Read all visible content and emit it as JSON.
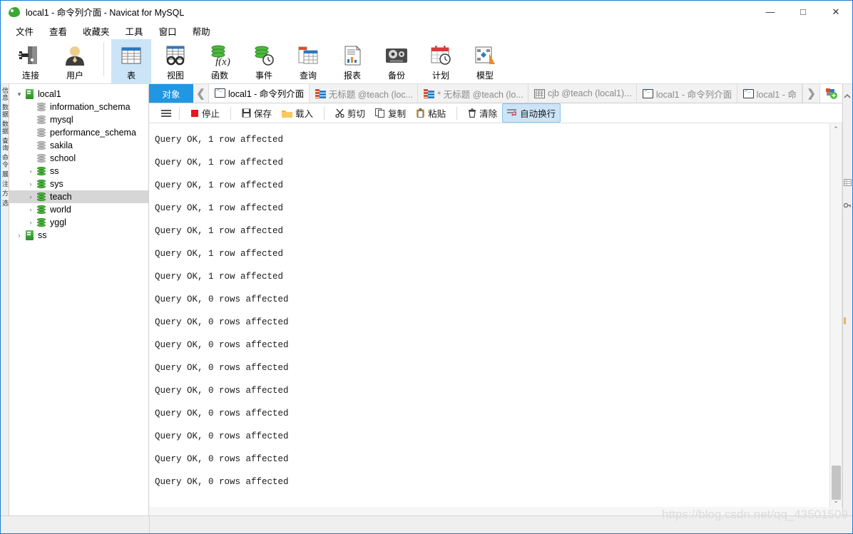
{
  "window": {
    "title": "local1 - 命令列介面 - Navicat for MySQL",
    "logo_icon": "navicat-leaf-icon",
    "minimize": "—",
    "maximize": "□",
    "close": "✕"
  },
  "menubar": {
    "items": [
      {
        "label": "文件",
        "name": "menu-file"
      },
      {
        "label": "查看",
        "name": "menu-view"
      },
      {
        "label": "收藏夹",
        "name": "menu-favorites"
      },
      {
        "label": "工具",
        "name": "menu-tools"
      },
      {
        "label": "窗口",
        "name": "menu-window"
      },
      {
        "label": "帮助",
        "name": "menu-help"
      }
    ]
  },
  "toolbar": {
    "buttons": [
      {
        "label": "连接",
        "icon": "connection-icon",
        "selected": false
      },
      {
        "label": "用户",
        "icon": "user-icon",
        "selected": false
      },
      {
        "label": "表",
        "icon": "table-icon",
        "selected": true
      },
      {
        "label": "视图",
        "icon": "view-icon",
        "selected": false
      },
      {
        "label": "函数",
        "icon": "function-icon",
        "selected": false
      },
      {
        "label": "事件",
        "icon": "event-icon",
        "selected": false
      },
      {
        "label": "查询",
        "icon": "query-icon",
        "selected": false
      },
      {
        "label": "报表",
        "icon": "report-icon",
        "selected": false
      },
      {
        "label": "备份",
        "icon": "backup-icon",
        "selected": false
      },
      {
        "label": "计划",
        "icon": "schedule-icon",
        "selected": false
      },
      {
        "label": "模型",
        "icon": "model-icon",
        "selected": false
      }
    ]
  },
  "left_dock": {
    "vertical_label": "信息 数据 数据 查询 命令 展 注 方 选"
  },
  "sidebar": {
    "tree": [
      {
        "label": "local1",
        "icon": "server-icon",
        "expander": "▾",
        "depth": 0,
        "selected": false
      },
      {
        "label": "information_schema",
        "icon": "database-gray-icon",
        "expander": "",
        "depth": 1,
        "selected": false
      },
      {
        "label": "mysql",
        "icon": "database-gray-icon",
        "expander": "",
        "depth": 1,
        "selected": false
      },
      {
        "label": "performance_schema",
        "icon": "database-gray-icon",
        "expander": "",
        "depth": 1,
        "selected": false
      },
      {
        "label": "sakila",
        "icon": "database-gray-icon",
        "expander": "",
        "depth": 1,
        "selected": false
      },
      {
        "label": "school",
        "icon": "database-gray-icon",
        "expander": "",
        "depth": 1,
        "selected": false
      },
      {
        "label": "ss",
        "icon": "database-green-icon",
        "expander": "›",
        "depth": 1,
        "selected": false
      },
      {
        "label": "sys",
        "icon": "database-green-icon",
        "expander": "›",
        "depth": 1,
        "selected": false
      },
      {
        "label": "teach",
        "icon": "database-green-icon",
        "expander": "›",
        "depth": 1,
        "selected": true
      },
      {
        "label": "world",
        "icon": "database-green-icon",
        "expander": "›",
        "depth": 1,
        "selected": false
      },
      {
        "label": "yggl",
        "icon": "database-green-icon",
        "expander": "›",
        "depth": 1,
        "selected": false
      },
      {
        "label": "ss",
        "icon": "server-icon",
        "expander": "›",
        "depth": 0,
        "selected": false
      }
    ]
  },
  "tabstrip": {
    "object_button": "对象",
    "scroll_left": "❮",
    "scroll_right": "❯",
    "new_tab_icon": "new-tab-icon",
    "tabs": [
      {
        "label": "local1 - 命令列介面",
        "icon": "console-icon",
        "active": true
      },
      {
        "label": "无标题 @teach (loc...",
        "icon": "query-icon",
        "active": false
      },
      {
        "label": "* 无标题 @teach (lo...",
        "icon": "query-icon",
        "active": false
      },
      {
        "label": "cjb @teach (local1)...",
        "icon": "table-icon",
        "active": false
      },
      {
        "label": "local1 - 命令列介面",
        "icon": "console-icon",
        "active": false
      },
      {
        "label": "local1 - 命",
        "icon": "console-icon",
        "active": false
      }
    ]
  },
  "actionbar": {
    "menu_icon": "hamburger-icon",
    "actions": [
      {
        "label": "停止",
        "icon": "stop-icon",
        "active": false
      },
      {
        "label": "保存",
        "icon": "save-icon",
        "active": false
      },
      {
        "label": "载入",
        "icon": "load-folder-icon",
        "active": false
      },
      {
        "label": "剪切",
        "icon": "cut-icon",
        "active": false
      },
      {
        "label": "复制",
        "icon": "copy-icon",
        "active": false
      },
      {
        "label": "粘贴",
        "icon": "paste-icon",
        "active": false
      },
      {
        "label": "清除",
        "icon": "trash-icon",
        "active": false
      },
      {
        "label": "自动换行",
        "icon": "wrap-icon",
        "active": true
      }
    ]
  },
  "console": {
    "lines": [
      "Query OK, 1 row affected",
      "Query OK, 1 row affected",
      "Query OK, 1 row affected",
      "Query OK, 1 row affected",
      "Query OK, 1 row affected",
      "Query OK, 1 row affected",
      "Query OK, 1 row affected",
      "Query OK, 0 rows affected",
      "Query OK, 0 rows affected",
      "Query OK, 0 rows affected",
      "Query OK, 0 rows affected",
      "Query OK, 0 rows affected",
      "Query OK, 0 rows affected",
      "Query OK, 0 rows affected",
      "Query OK, 0 rows affected",
      "Query OK, 0 rows affected"
    ],
    "scroll_up": "⌃",
    "scroll_down": "⌄"
  },
  "statusbar": {
    "watermark": "https://blog.csdn.net/qq_43501509"
  }
}
